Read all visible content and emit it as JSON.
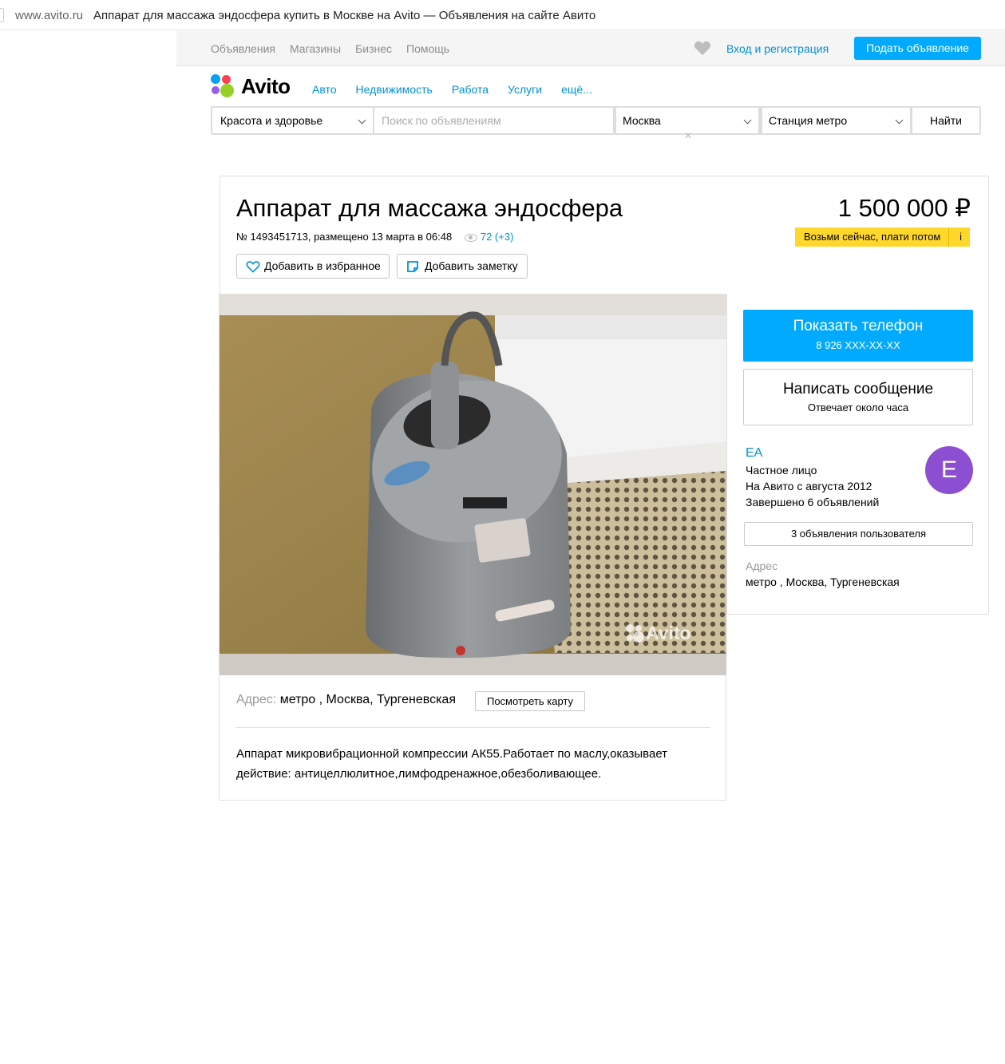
{
  "browser": {
    "domain": "www.avito.ru",
    "title": "Аппарат для массажа эндосфера купить в Москве на Avito — Объявления на сайте Авито"
  },
  "topnav": {
    "links": [
      "Объявления",
      "Магазины",
      "Бизнес",
      "Помощь"
    ],
    "login": "Вход и регистрация",
    "post_ad": "Подать объявление"
  },
  "logo": {
    "text": "Avito"
  },
  "categories": [
    "Авто",
    "Недвижимость",
    "Работа",
    "Услуги",
    "ещё..."
  ],
  "search": {
    "category": "Красота и здоровье",
    "placeholder": "Поиск по объявлениям",
    "city": "Москва",
    "metro": "Станция метро",
    "submit": "Найти"
  },
  "item": {
    "title": "Аппарат для массажа эндосфера",
    "meta": "№ 1493451713, размещено 13 марта в 06:48",
    "views": "72 (+3)",
    "price": "1 500 000 ₽",
    "promo": "Возьми сейчас, плати потом",
    "promo_info": "i",
    "favorite": "Добавить в избранное",
    "note": "Добавить заметку",
    "watermark": "Avito",
    "address_label": "Адрес:",
    "address": "метро , Москва, Тургеневская",
    "map_button": "Посмотреть карту",
    "description_l1": "Аппарат микровибрационной компрессии АК55.Работает по маслу,оказывает",
    "description_l2": "действие: антицеллюлитное,лимфодренажное,обезболивающее."
  },
  "seller": {
    "phone_title": "Показать телефон",
    "phone_number": "8 926 XXX-XX-XX",
    "message_title": "Написать сообщение",
    "message_sub": "Отвечает около часа",
    "name": "EA",
    "type": "Частное лицо",
    "since": "На Авито с августа 2012",
    "completed": "Завершено 6 объявлений",
    "avatar_letter": "E",
    "ads_button": "3 объявления пользователя",
    "address_label": "Адрес",
    "address": "метро , Москва, Тургеневская"
  },
  "colors": {
    "accent": "#00aaff",
    "link": "#0091d9",
    "promo": "#ffd82b",
    "avatar": "#8c4fd1"
  }
}
